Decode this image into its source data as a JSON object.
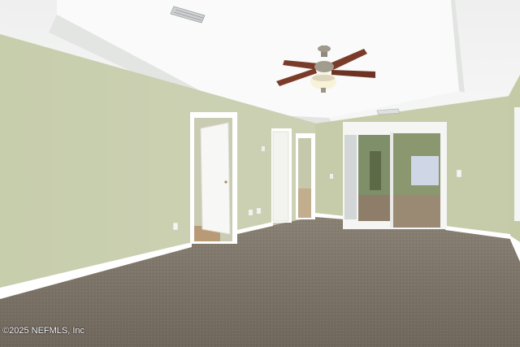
{
  "watermark": {
    "text": "©2025 NEFMLS, Inc"
  },
  "colors": {
    "wall": "#c9cfaf",
    "ceiling": "#f4f5f4",
    "carpet": "#7d7469",
    "trim": "#ffffff",
    "fan_blade": "#7a3b2a"
  },
  "icons": [
    "ceiling-fan-icon",
    "air-vent-icon",
    "light-switch-icon",
    "power-outlet-icon"
  ]
}
